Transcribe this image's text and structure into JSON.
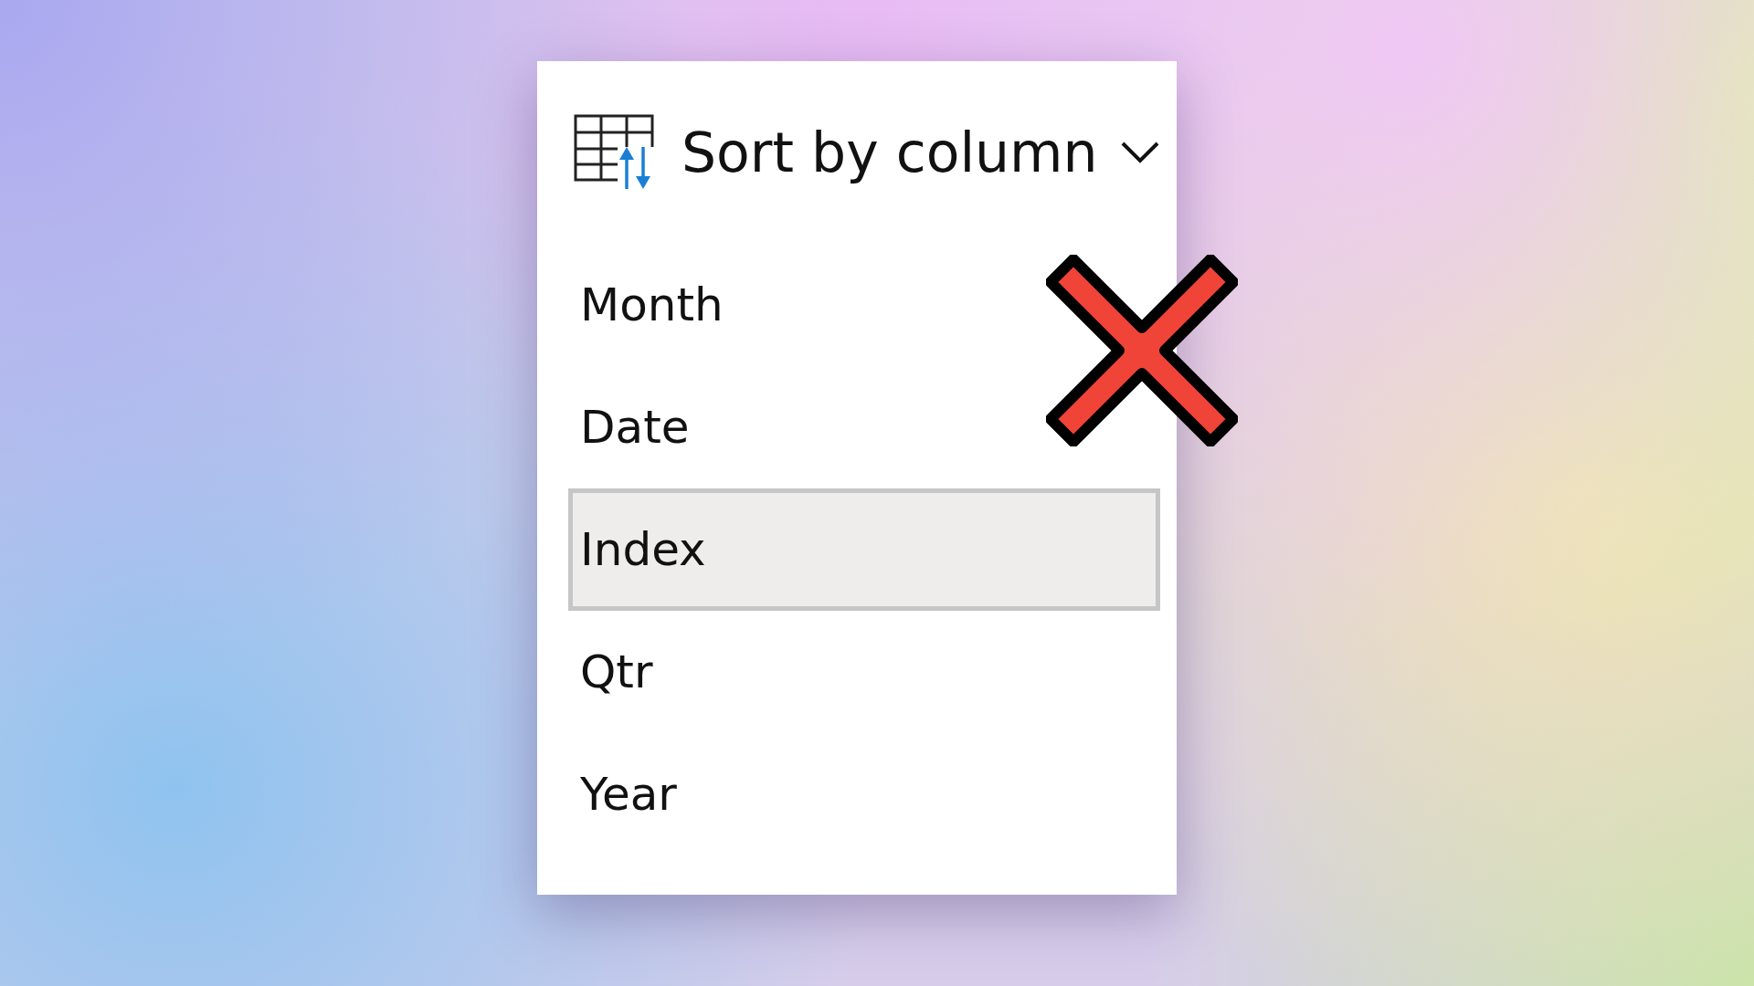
{
  "menu": {
    "title": "Sort by column",
    "items": [
      {
        "label": "Month",
        "selected": false
      },
      {
        "label": "Date",
        "selected": false
      },
      {
        "label": "Index",
        "selected": true
      },
      {
        "label": "Qtr",
        "selected": false
      },
      {
        "label": "Year",
        "selected": false
      }
    ]
  }
}
